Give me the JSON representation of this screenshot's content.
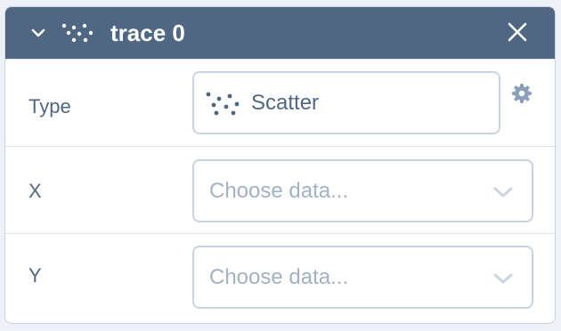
{
  "header": {
    "title": "trace 0",
    "icons": [
      "chevron-down-icon",
      "scatter-icon",
      "close-icon"
    ],
    "background": "#506784"
  },
  "fields": {
    "type": {
      "label": "Type",
      "value": "Scatter",
      "icon": "scatter-icon",
      "settings_icon": "gear-icon"
    },
    "x": {
      "label": "X",
      "placeholder": "Choose data..."
    },
    "y": {
      "label": "Y",
      "placeholder": "Choose data..."
    }
  },
  "colors": {
    "text": "#506784",
    "placeholder": "#a2b1c6",
    "border": "#c8d4e3"
  }
}
